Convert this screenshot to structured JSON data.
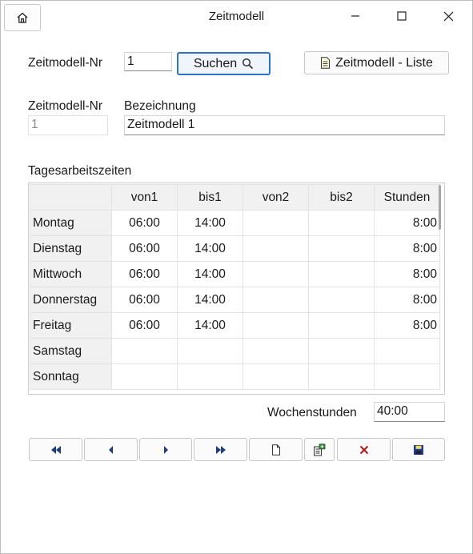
{
  "window": {
    "title": "Zeitmodell"
  },
  "search": {
    "nr_label": "Zeitmodell-Nr",
    "nr_value": "1",
    "search_button": "Suchen",
    "list_button": "Zeitmodell - Liste"
  },
  "details": {
    "nr_label": "Zeitmodell-Nr",
    "nr_value": "1",
    "bez_label": "Bezeichnung",
    "bez_value": "Zeitmodell 1"
  },
  "grid": {
    "section_label": "Tagesarbeitszeiten",
    "columns": [
      "",
      "von1",
      "bis1",
      "von2",
      "bis2",
      "Stunden"
    ],
    "rows": [
      {
        "day": "Montag",
        "von1": "06:00",
        "bis1": "14:00",
        "von2": "",
        "bis2": "",
        "stunden": "8:00"
      },
      {
        "day": "Dienstag",
        "von1": "06:00",
        "bis1": "14:00",
        "von2": "",
        "bis2": "",
        "stunden": "8:00"
      },
      {
        "day": "Mittwoch",
        "von1": "06:00",
        "bis1": "14:00",
        "von2": "",
        "bis2": "",
        "stunden": "8:00"
      },
      {
        "day": "Donnerstag",
        "von1": "06:00",
        "bis1": "14:00",
        "von2": "",
        "bis2": "",
        "stunden": "8:00"
      },
      {
        "day": "Freitag",
        "von1": "06:00",
        "bis1": "14:00",
        "von2": "",
        "bis2": "",
        "stunden": "8:00"
      },
      {
        "day": "Samstag",
        "von1": "",
        "bis1": "",
        "von2": "",
        "bis2": "",
        "stunden": ""
      },
      {
        "day": "Sonntag",
        "von1": "",
        "bis1": "",
        "von2": "",
        "bis2": "",
        "stunden": ""
      }
    ]
  },
  "summary": {
    "wochen_label": "Wochenstunden",
    "wochen_value": "40:00"
  },
  "toolbar": {
    "icons": [
      "first-record-icon",
      "previous-record-icon",
      "next-record-icon",
      "last-record-icon",
      "new-record-icon",
      "copy-record-icon",
      "delete-record-icon",
      "save-record-icon"
    ],
    "accent": "#2a73c9",
    "delete_color": "#b01818",
    "save_color": "#1f3a9c"
  }
}
